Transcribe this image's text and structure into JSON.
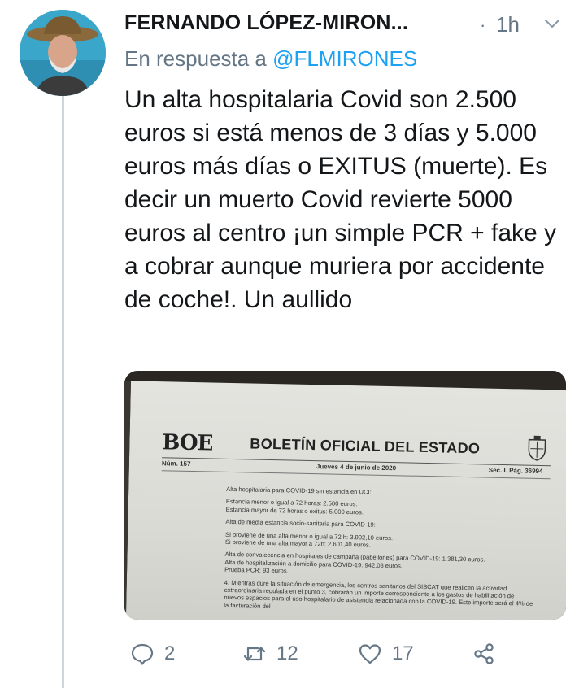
{
  "tweet": {
    "author_name": "FERNANDO LÓPEZ-MIRON...",
    "separator": "·",
    "time": "1h",
    "reply_prefix": "En respuesta a",
    "reply_handle": "@FLMIRONES",
    "text": "Un alta hospitalaria Covid son 2.500 euros si está menos de 3 días y 5.000 euros más días o EXITUS (muerte). Es decir un muerto Covid revierte 5000 euros al centro ¡un simple PCR + fake y a cobrar aunque muriera por accidente de coche!. Un aullido"
  },
  "media_doc": {
    "logo": "BOE",
    "title": "BOLETÍN OFICIAL DEL ESTADO",
    "num": "Núm. 157",
    "date": "Jueves 4 de junio de 2020",
    "section": "Sec. I.  Pág. 36994",
    "lines": [
      "Alta hospitalaria para COVID-19 sin estancia en UCI:",
      "Estancia menor o igual a 72 horas: 2.500 euros.\nEstancia mayor de 72 horas o exitus: 5.000 euros.",
      "Alta de media estancia socio-sanitaria para COVID-19:",
      "Si proviene de una alta menor o igual a 72 h: 3.902,10 euros.\nSi proviene de una alta mayor a 72h: 2.601,40 euros.",
      "Alta de convalecencia en hospitales de campaña (pabellones) para COVID-19: 1.381,30 euros.\nAlta de hospitalización a domicilio para COVID-19: 942,08 euros.\nPrueba PCR: 93 euros.",
      "4. Mientras dure la situación de emergencia, los centros sanitarios del SISCAT que realicen la actividad extraordinaria regulada en el punto 3, cobrarán un importe correspondiente a los gastos de habilitación de nuevos espacios para el uso hospitalario de asistencia relacionada con la COVID-19. Este importe será el 4% de la facturación del"
    ]
  },
  "actions": {
    "reply_count": "2",
    "retweet_count": "12",
    "like_count": "17"
  },
  "colors": {
    "secondary_text": "#657786",
    "link": "#1da1f2",
    "thread_line": "#ccd6dd"
  },
  "icons": [
    "reply-icon",
    "retweet-icon",
    "like-icon",
    "share-icon",
    "chevron-down-icon"
  ]
}
